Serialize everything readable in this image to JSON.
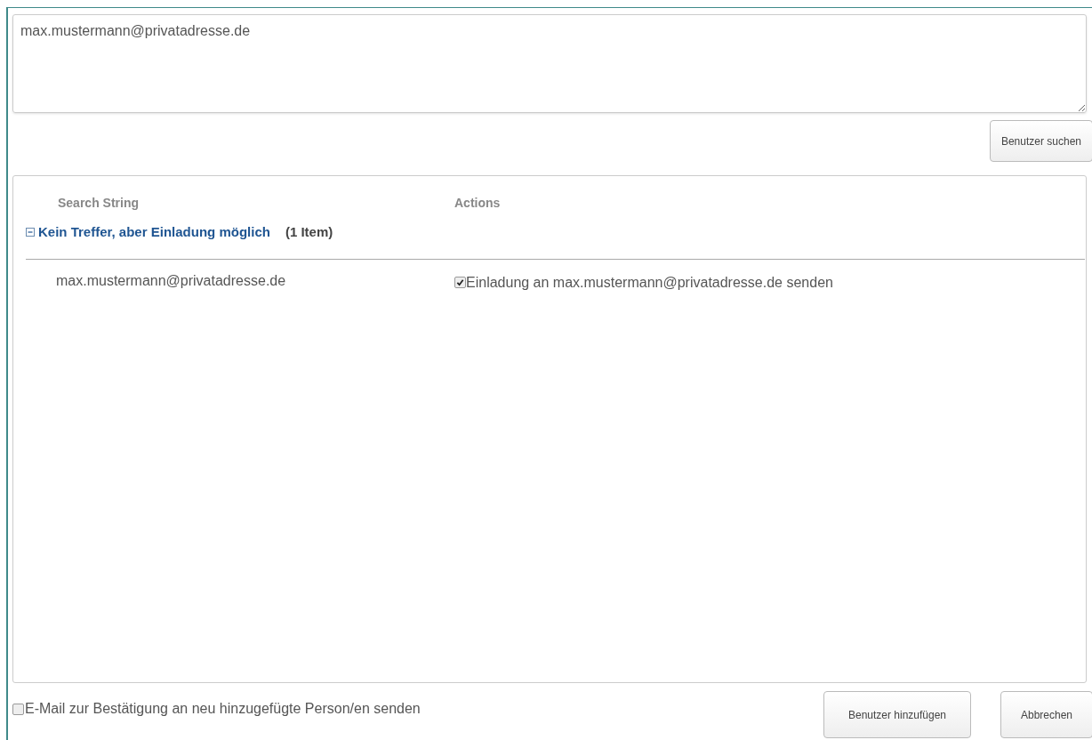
{
  "search_input": {
    "value": "max.mustermann@privatadresse.de"
  },
  "search_button": "Benutzer suchen",
  "results": {
    "columns": [
      "Search String",
      "Actions"
    ],
    "groups": [
      {
        "title": "Kein Treffer, aber Einladung möglich",
        "count": "(1 Item)",
        "expanded": true,
        "items": [
          {
            "search_string": "max.mustermann@privatadresse.de",
            "action": "Einladung an max.mustermann@privatadresse.de senden",
            "checked": true
          }
        ]
      }
    ]
  },
  "confirm_email": {
    "label": "E-Mail zur Bestätigung an neu hinzugefügte Person/en senden",
    "checked": false
  },
  "buttons": [
    "Benutzer hinzufügen",
    "Abbrechen"
  ]
}
